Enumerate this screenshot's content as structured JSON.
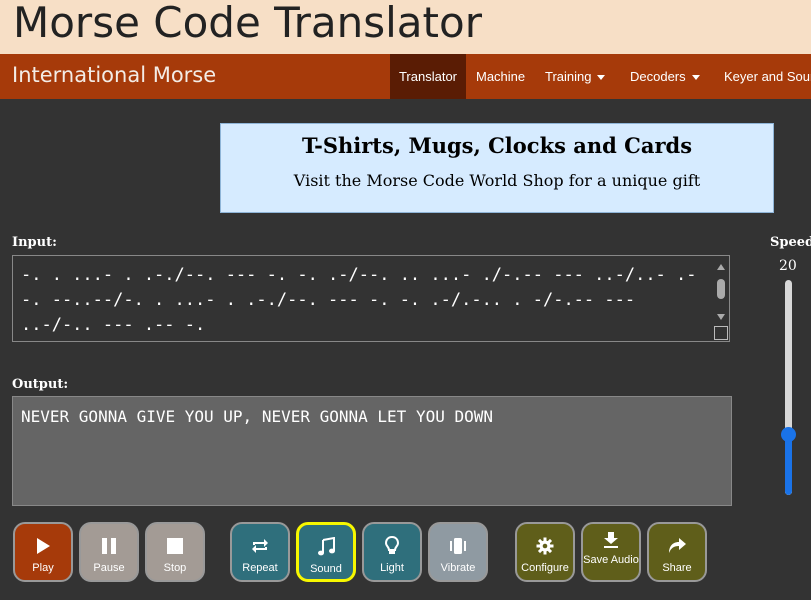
{
  "header": {
    "title": "Morse Code Translator"
  },
  "navbar": {
    "brand": "International Morse",
    "items": [
      {
        "label": "Translator",
        "active": true,
        "dropdown": false
      },
      {
        "label": "Machine",
        "active": false,
        "dropdown": false
      },
      {
        "label": "Training",
        "active": false,
        "dropdown": true
      },
      {
        "label": "Decoders",
        "active": false,
        "dropdown": true
      },
      {
        "label": "Keyer and Sour",
        "active": false,
        "dropdown": false
      }
    ]
  },
  "ad": {
    "title": "T-Shirts, Mugs, Clocks and Cards",
    "subtitle": "Visit the Morse Code World Shop for a unique gift"
  },
  "input": {
    "label": "Input:",
    "value": "-. . ...- . .-./--. --- -. -. .-/--. .. ...- ./-.-- --- ..-/..- .--. --..--/-. . ...- . .-./--. --- -. -. .-/.-.. . -/-.-- --- ..-/-.. --- .-- -."
  },
  "output": {
    "label": "Output:",
    "value": "NEVER GONNA GIVE YOU UP, NEVER GONNA LET YOU DOWN"
  },
  "speed": {
    "label": "Speed",
    "value": "20",
    "min": 5,
    "max": 50,
    "level": 0.28
  },
  "buttons": {
    "play": "Play",
    "pause": "Pause",
    "stop": "Stop",
    "repeat": "Repeat",
    "sound": "Sound",
    "light": "Light",
    "vibrate": "Vibrate",
    "configure": "Configure",
    "save_audio": "Save Audio",
    "share": "Share"
  },
  "icons": {
    "play": "play-icon",
    "pause": "pause-icon",
    "stop": "stop-icon",
    "repeat": "repeat-icon",
    "sound": "music-note-icon",
    "light": "lightbulb-icon",
    "vibrate": "vibrate-icon",
    "configure": "gear-icon",
    "save_audio": "download-icon",
    "share": "share-icon"
  },
  "colors": {
    "header_bg": "#f7dfc6",
    "navbar_bg": "#a63a0a",
    "nav_active": "#5a1c04",
    "page_bg": "#333333",
    "ad_bg": "#d6ebff",
    "play_group": "#a63a0a",
    "transport_group": "#a39b95",
    "output_group": "#2f6f7c",
    "vibrate_disabled": "#8f9aa2",
    "tools_group": "#5f5e1a",
    "slider_accent": "#1a73e8",
    "selected_outline": "#f7f700"
  },
  "state": {
    "selected_output": "Sound"
  }
}
